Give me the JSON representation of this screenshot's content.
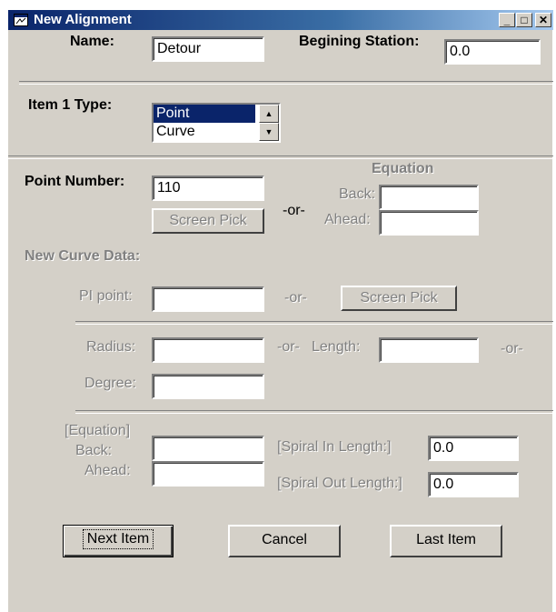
{
  "window": {
    "title": "New Alignment",
    "minimize": "_",
    "maximize": "□",
    "close": "✕"
  },
  "name": {
    "label": "Name:",
    "value": "Detour"
  },
  "station": {
    "label": "Begining Station:",
    "value": "0.0"
  },
  "item_type": {
    "label": "Item 1 Type:",
    "options": [
      "Point",
      "Curve"
    ],
    "selected": "Point",
    "scroll_up": "▲",
    "scroll_down": "▼"
  },
  "point": {
    "label": "Point Number:",
    "value": "110",
    "screen_pick": "Screen Pick",
    "or": "-or-",
    "equation_label": "Equation",
    "back_label": "Back:",
    "back_value": "",
    "ahead_label": "Ahead:",
    "ahead_value": ""
  },
  "curve": {
    "section_label": "New Curve Data:",
    "pi_label": "PI point:",
    "pi_value": "",
    "pi_or": "-or-",
    "screen_pick": "Screen Pick",
    "radius_label": "Radius:",
    "radius_value": "",
    "radius_or": "-or-",
    "length_label": "Length:",
    "length_value": "",
    "length_or": "-or-",
    "degree_label": "Degree:",
    "degree_value": "",
    "equation_label": "[Equation]",
    "back_label": "Back:",
    "back_value": "",
    "ahead_label": "Ahead:",
    "ahead_value": "",
    "spiral_in_label": "[Spiral In Length:]",
    "spiral_in_value": "0.0",
    "spiral_out_label": "[Spiral Out Length:]",
    "spiral_out_value": "0.0"
  },
  "buttons": {
    "next": "Next Item",
    "cancel": "Cancel",
    "last": "Last Item"
  }
}
